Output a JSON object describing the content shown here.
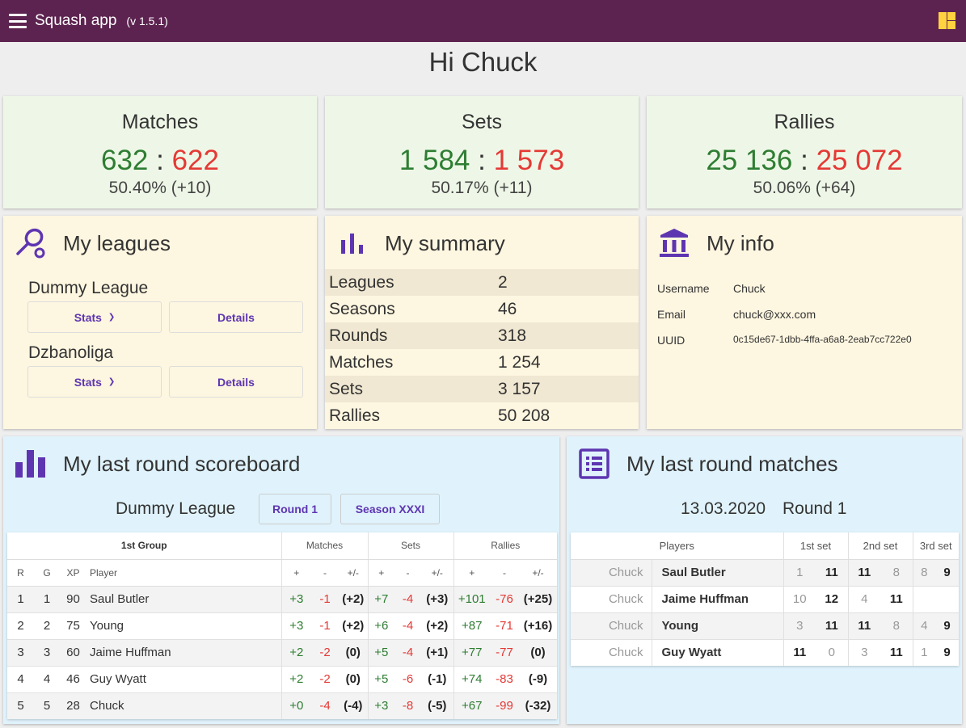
{
  "header": {
    "title": "Squash app",
    "version": "(v 1.5.1)"
  },
  "greeting": "Hi Chuck",
  "stats": {
    "matches": {
      "title": "Matches",
      "won": "632",
      "lost": "622",
      "pct": "50.40% (+10)"
    },
    "sets": {
      "title": "Sets",
      "won": "1 584",
      "lost": "1 573",
      "pct": "50.17% (+11)"
    },
    "rallies": {
      "title": "Rallies",
      "won": "25 136",
      "lost": "25 072",
      "pct": "50.06% (+64)"
    }
  },
  "leagues": {
    "title": "My leagues",
    "items": [
      {
        "name": "Dummy League",
        "stats": "Stats",
        "details": "Details"
      },
      {
        "name": "Dzbanoliga",
        "stats": "Stats",
        "details": "Details"
      }
    ]
  },
  "summary": {
    "title": "My summary",
    "rows": [
      {
        "k": "Leagues",
        "v": "2"
      },
      {
        "k": "Seasons",
        "v": "46"
      },
      {
        "k": "Rounds",
        "v": "318"
      },
      {
        "k": "Matches",
        "v": "1 254"
      },
      {
        "k": "Sets",
        "v": "3 157"
      },
      {
        "k": "Rallies",
        "v": "50 208"
      }
    ]
  },
  "info": {
    "title": "My info",
    "rows": [
      {
        "k": "Username",
        "v": "Chuck"
      },
      {
        "k": "Email",
        "v": "chuck@xxx.com"
      },
      {
        "k": "UUID",
        "v": "0c15de67-1dbb-4ffa-a6a8-2eab7cc722e0"
      }
    ]
  },
  "scoreboard": {
    "title": "My last round scoreboard",
    "league": "Dummy League",
    "round_btn": "Round 1",
    "season_btn": "Season XXXI",
    "group": "1st Group",
    "col_matches": "Matches",
    "col_sets": "Sets",
    "col_rallies": "Rallies",
    "sub": [
      "R",
      "G",
      "XP",
      "Player",
      "+",
      "-",
      "+/-",
      "+",
      "-",
      "+/-",
      "+",
      "-",
      "+/-"
    ],
    "rows": [
      [
        "1",
        "1",
        "90",
        "Saul Butler",
        "+3",
        "-1",
        "(+2)",
        "+7",
        "-4",
        "(+3)",
        "+101",
        "-76",
        "(+25)"
      ],
      [
        "2",
        "2",
        "75",
        "Young",
        "+3",
        "-1",
        "(+2)",
        "+6",
        "-4",
        "(+2)",
        "+87",
        "-71",
        "(+16)"
      ],
      [
        "3",
        "3",
        "60",
        "Jaime Huffman",
        "+2",
        "-2",
        "(0)",
        "+5",
        "-4",
        "(+1)",
        "+77",
        "-77",
        "(0)"
      ],
      [
        "4",
        "4",
        "46",
        "Guy Wyatt",
        "+2",
        "-2",
        "(0)",
        "+5",
        "-6",
        "(-1)",
        "+74",
        "-83",
        "(-9)"
      ],
      [
        "5",
        "5",
        "28",
        "Chuck",
        "+0",
        "-4",
        "(-4)",
        "+3",
        "-8",
        "(-5)",
        "+67",
        "-99",
        "(-32)"
      ]
    ]
  },
  "matches": {
    "title": "My last round matches",
    "date": "13.03.2020",
    "round": "Round 1",
    "headers": [
      "Players",
      "1st set",
      "2nd set",
      "3rd set"
    ],
    "rows": [
      {
        "me": "Chuck",
        "opp": "Saul Butler",
        "s": [
          [
            "1",
            "11"
          ],
          [
            "11",
            "8"
          ],
          [
            "8",
            "9"
          ]
        ]
      },
      {
        "me": "Chuck",
        "opp": "Jaime Huffman",
        "s": [
          [
            "10",
            "12"
          ],
          [
            "4",
            "11"
          ],
          [
            "",
            ""
          ]
        ]
      },
      {
        "me": "Chuck",
        "opp": "Young",
        "s": [
          [
            "3",
            "11"
          ],
          [
            "11",
            "8"
          ],
          [
            "4",
            "9"
          ]
        ]
      },
      {
        "me": "Chuck",
        "opp": "Guy Wyatt",
        "s": [
          [
            "11",
            "0"
          ],
          [
            "3",
            "11"
          ],
          [
            "1",
            "9"
          ]
        ]
      }
    ]
  },
  "colors": {
    "topbar": "#5d2350",
    "accent": "#5e35b1",
    "win": "#2e7d32",
    "loss": "#e53935",
    "dashboard_icon": "#ffd23f"
  }
}
